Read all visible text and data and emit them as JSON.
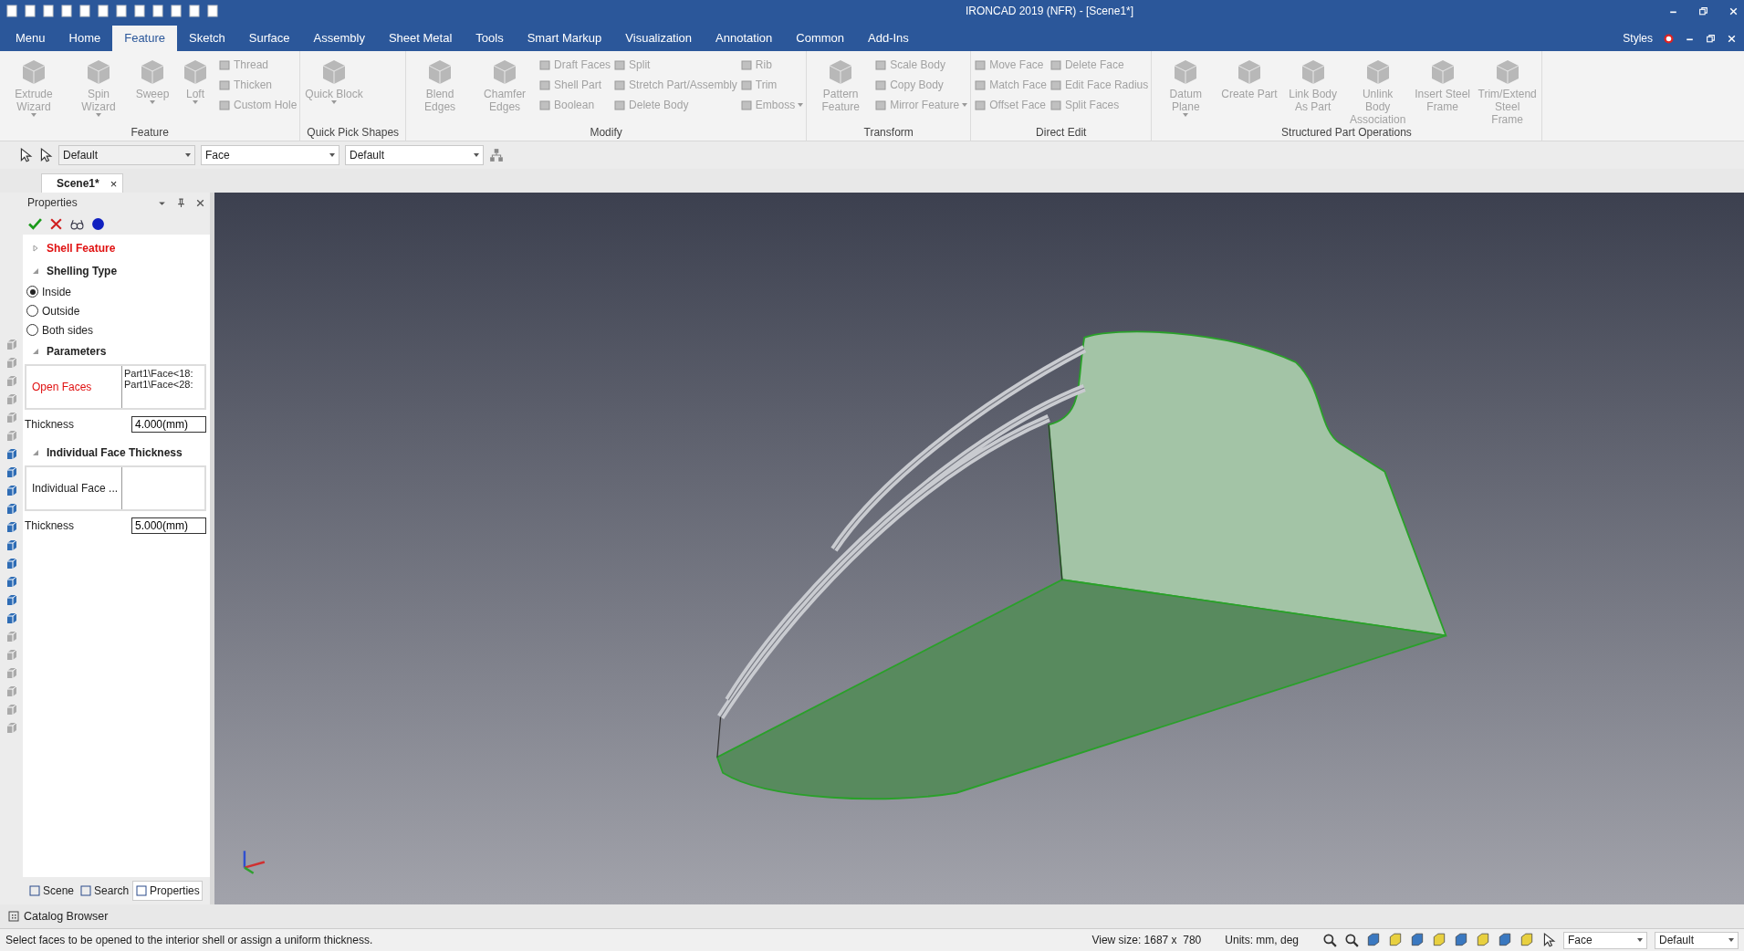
{
  "window": {
    "title": "IRONCAD 2019 (NFR) - [Scene1*]"
  },
  "menu_tabs": [
    {
      "label": "Menu",
      "selected": false
    },
    {
      "label": "Home",
      "selected": false
    },
    {
      "label": "Feature",
      "selected": true
    },
    {
      "label": "Sketch",
      "selected": false
    },
    {
      "label": "Surface",
      "selected": false
    },
    {
      "label": "Assembly",
      "selected": false
    },
    {
      "label": "Sheet Metal",
      "selected": false
    },
    {
      "label": "Tools",
      "selected": false
    },
    {
      "label": "Smart Markup",
      "selected": false
    },
    {
      "label": "Visualization",
      "selected": false
    },
    {
      "label": "Annotation",
      "selected": false
    },
    {
      "label": "Common",
      "selected": false
    },
    {
      "label": "Add-Ins",
      "selected": false
    }
  ],
  "styles_menu": "Styles",
  "ribbon": {
    "groups": [
      {
        "label": "Feature",
        "large": [
          {
            "label": "Extrude Wizard",
            "dropdown": true,
            "disabled": true
          },
          {
            "label": "Spin Wizard",
            "dropdown": true,
            "disabled": true
          },
          {
            "label": "Sweep",
            "dropdown": true,
            "disabled": true
          },
          {
            "label": "Loft",
            "dropdown": true,
            "disabled": true
          }
        ],
        "small_columns": [
          [
            {
              "label": "Thread",
              "dropdown": false,
              "disabled": true
            },
            {
              "label": "Thicken",
              "dropdown": false,
              "disabled": true
            },
            {
              "label": "Custom Hole",
              "dropdown": false,
              "disabled": true
            }
          ]
        ]
      },
      {
        "label": "Quick Pick Shapes",
        "large": [
          {
            "label": "Quick Block",
            "dropdown": true,
            "disabled": true
          }
        ]
      },
      {
        "label": "Modify",
        "large": [
          {
            "label": "Blend Edges",
            "dropdown": false,
            "disabled": true
          },
          {
            "label": "Chamfer Edges",
            "dropdown": false,
            "disabled": true
          }
        ],
        "small_columns": [
          [
            {
              "label": "Draft Faces",
              "dropdown": false,
              "disabled": true
            },
            {
              "label": "Shell Part",
              "dropdown": false,
              "disabled": true
            },
            {
              "label": "Boolean",
              "dropdown": false,
              "disabled": true
            }
          ],
          [
            {
              "label": "Split",
              "dropdown": false,
              "disabled": true
            },
            {
              "label": "Stretch Part/Assembly",
              "dropdown": false,
              "disabled": true
            },
            {
              "label": "Delete Body",
              "dropdown": false,
              "disabled": true
            }
          ],
          [
            {
              "label": "Rib",
              "dropdown": false,
              "disabled": true
            },
            {
              "label": "Trim",
              "dropdown": false,
              "disabled": true
            },
            {
              "label": "Emboss",
              "dropdown": true,
              "disabled": true
            }
          ]
        ]
      },
      {
        "label": "Transform",
        "large": [
          {
            "label": "Pattern Feature",
            "dropdown": false,
            "disabled": true
          }
        ],
        "small_columns": [
          [
            {
              "label": "Scale Body",
              "dropdown": false,
              "disabled": true
            },
            {
              "label": "Copy Body",
              "dropdown": false,
              "disabled": true
            },
            {
              "label": "Mirror Feature",
              "dropdown": true,
              "disabled": true
            }
          ]
        ]
      },
      {
        "label": "Direct Edit",
        "small_columns": [
          [
            {
              "label": "Move Face",
              "dropdown": false,
              "disabled": true
            },
            {
              "label": "Match Face",
              "dropdown": false,
              "disabled": true
            },
            {
              "label": "Offset Face",
              "dropdown": false,
              "disabled": true
            }
          ],
          [
            {
              "label": "Delete Face",
              "dropdown": false,
              "disabled": true
            },
            {
              "label": "Edit Face Radius",
              "dropdown": false,
              "disabled": true
            },
            {
              "label": "Split Faces",
              "dropdown": false,
              "disabled": true
            }
          ]
        ]
      },
      {
        "label": "Structured Part Operations",
        "large": [
          {
            "label": "Datum Plane",
            "dropdown": true,
            "disabled": true
          },
          {
            "label": "Create Part",
            "dropdown": false,
            "disabled": true
          },
          {
            "label": "Link Body As Part",
            "dropdown": false,
            "disabled": true
          },
          {
            "label": "Unlink Body Association",
            "dropdown": false,
            "disabled": true
          },
          {
            "label": "Insert Steel Frame",
            "dropdown": false,
            "disabled": true
          },
          {
            "label": "Trim/Extend Steel Frame",
            "dropdown": false,
            "disabled": true
          }
        ]
      }
    ]
  },
  "toolbar": {
    "dropdowns": [
      {
        "value": "Default",
        "disabled": true
      },
      {
        "value": "Face",
        "disabled": false
      },
      {
        "value": "Default",
        "disabled": false
      }
    ]
  },
  "document_tab": {
    "label": "Scene1*",
    "close": "×"
  },
  "properties": {
    "title": "Properties",
    "sections": [
      {
        "kind": "header",
        "title": "Shell Feature",
        "expanded": false
      },
      {
        "kind": "radios",
        "title": "Shelling Type",
        "expanded": true,
        "options": [
          {
            "label": "Inside",
            "selected": true
          },
          {
            "label": "Outside",
            "selected": false
          },
          {
            "label": "Both sides",
            "selected": false
          }
        ]
      },
      {
        "kind": "fields",
        "title": "Parameters",
        "expanded": true,
        "list": {
          "label": "Open Faces",
          "items": [
            "Part1\\Face<18:",
            "Part1\\Face<28:"
          ]
        },
        "thickness": {
          "label": "Thickness",
          "value": "4.000(mm)"
        }
      },
      {
        "kind": "fields",
        "title": "Individual Face Thickness",
        "expanded": true,
        "list": {
          "label": "Individual Face ..."
        },
        "thickness": {
          "label": "Thickness",
          "value": "5.000(mm)"
        }
      }
    ]
  },
  "panel_tabs": [
    {
      "label": "Scene",
      "selected": false
    },
    {
      "label": "Search",
      "selected": false
    },
    {
      "label": "Properties",
      "selected": true
    }
  ],
  "catalog_browser": "Catalog Browser",
  "status_bar": {
    "message": "Select faces to be opened to the interior shell or assign a uniform thickness.",
    "view_size": "View size: 1687 x  780",
    "units": "Units: mm, deg",
    "dropdowns": [
      "Face",
      "Default"
    ]
  }
}
